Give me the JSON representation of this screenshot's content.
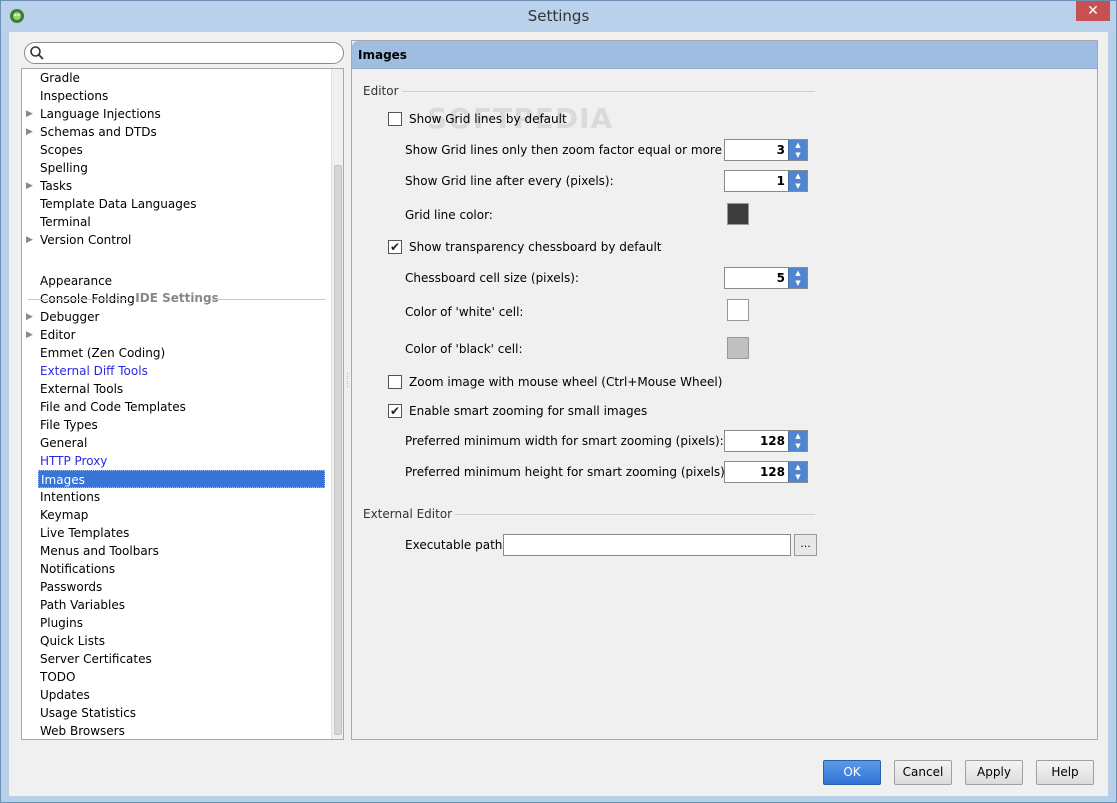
{
  "window": {
    "title": "Settings",
    "close_glyph": "✕"
  },
  "search": {
    "value": "",
    "placeholder": ""
  },
  "tree": {
    "top_items": [
      {
        "label": "Gradle",
        "expandable": false
      },
      {
        "label": "Inspections",
        "expandable": false
      },
      {
        "label": "Language Injections",
        "expandable": true
      },
      {
        "label": "Schemas and DTDs",
        "expandable": true
      },
      {
        "label": "Scopes",
        "expandable": false
      },
      {
        "label": "Spelling",
        "expandable": false
      },
      {
        "label": "Tasks",
        "expandable": true
      },
      {
        "label": "Template Data Languages",
        "expandable": false
      },
      {
        "label": "Terminal",
        "expandable": false
      },
      {
        "label": "Version Control",
        "expandable": true
      }
    ],
    "group_header": "IDE Settings",
    "ide_items": [
      {
        "label": "Appearance"
      },
      {
        "label": "Console Folding"
      },
      {
        "label": "Debugger",
        "expandable": true
      },
      {
        "label": "Editor",
        "expandable": true
      },
      {
        "label": "Emmet (Zen Coding)"
      },
      {
        "label": "External Diff Tools",
        "link": true
      },
      {
        "label": "External Tools"
      },
      {
        "label": "File and Code Templates"
      },
      {
        "label": "File Types"
      },
      {
        "label": "General"
      },
      {
        "label": "HTTP Proxy",
        "link": true
      },
      {
        "label": "Images",
        "selected": true
      },
      {
        "label": "Intentions"
      },
      {
        "label": "Keymap"
      },
      {
        "label": "Live Templates"
      },
      {
        "label": "Menus and Toolbars"
      },
      {
        "label": "Notifications"
      },
      {
        "label": "Passwords"
      },
      {
        "label": "Path Variables"
      },
      {
        "label": "Plugins"
      },
      {
        "label": "Quick Lists"
      },
      {
        "label": "Server Certificates"
      },
      {
        "label": "TODO"
      },
      {
        "label": "Updates"
      },
      {
        "label": "Usage Statistics"
      },
      {
        "label": "Web Browsers"
      }
    ]
  },
  "panel": {
    "title": "Images",
    "watermark": "SOFTPEDIA",
    "editor_section": "Editor",
    "show_grid": {
      "label": "Show Grid lines by default",
      "checked": false
    },
    "grid_zoom": {
      "label": "Show Grid lines only then zoom factor equal or more than:",
      "value": "3"
    },
    "grid_every": {
      "label": "Show Grid line after every (pixels):",
      "value": "1"
    },
    "grid_color": {
      "label": "Grid line color:",
      "color": "#3c3c3c"
    },
    "show_chessboard": {
      "label": "Show transparency chessboard by default",
      "checked": true
    },
    "chess_size": {
      "label": "Chessboard cell size (pixels):",
      "value": "5"
    },
    "white_cell": {
      "label": "Color of 'white' cell:",
      "color": "#ffffff"
    },
    "black_cell": {
      "label": "Color of 'black' cell:",
      "color": "#c0c0c0"
    },
    "zoom_wheel": {
      "label": "Zoom image with mouse wheel (Ctrl+Mouse Wheel)",
      "checked": false
    },
    "smart_zoom": {
      "label": "Enable smart zooming for small images",
      "checked": true
    },
    "min_width": {
      "label": "Preferred minimum width for smart zooming (pixels):",
      "value": "128"
    },
    "min_height": {
      "label": "Preferred minimum height for smart zooming (pixels):",
      "value": "128"
    },
    "external_section": "External Editor",
    "exec_path": {
      "label": "Executable path:",
      "value": "",
      "browse": "..."
    }
  },
  "buttons": {
    "ok": "OK",
    "cancel": "Cancel",
    "apply": "Apply",
    "help": "Help"
  },
  "colors": {
    "accent": "#3875d7",
    "header": "#9ebde0",
    "link": "#2a2adf"
  }
}
